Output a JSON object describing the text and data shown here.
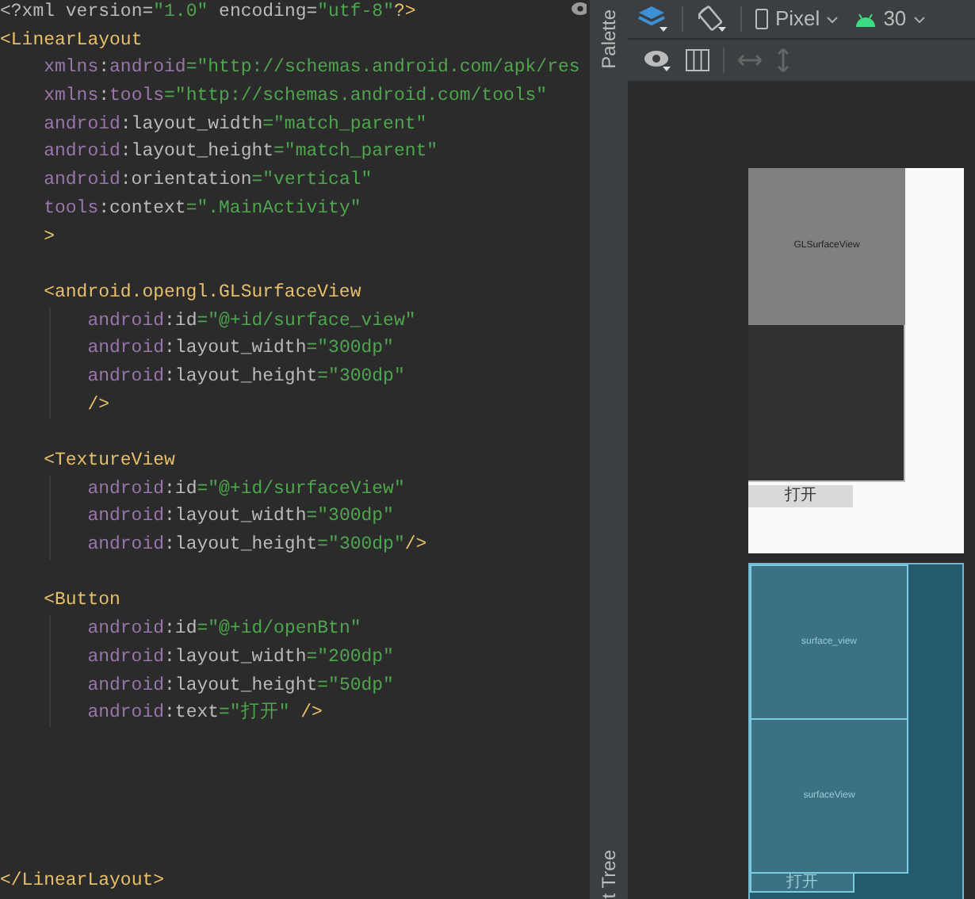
{
  "editor": {
    "prolog": [
      {
        "kind": "punct",
        "text": "<?xml version="
      },
      {
        "kind": "value",
        "text": "\"1.0\""
      },
      {
        "kind": "punct",
        "text": " encoding="
      },
      {
        "kind": "value",
        "text": "\"utf-8\""
      },
      {
        "kind": "tag",
        "text": "?>"
      }
    ],
    "root": {
      "open": [
        {
          "kind": "tag",
          "text": "<LinearLayout"
        }
      ],
      "attrs": [
        [
          {
            "kind": "ns",
            "text": "xmlns"
          },
          {
            "kind": "punct",
            "text": ":"
          },
          {
            "kind": "ns",
            "text": "android"
          },
          {
            "kind": "value",
            "text": "=\"http://schemas.android.com/apk/res"
          }
        ],
        [
          {
            "kind": "ns",
            "text": "xmlns"
          },
          {
            "kind": "punct",
            "text": ":"
          },
          {
            "kind": "ns",
            "text": "tools"
          },
          {
            "kind": "value",
            "text": "=\"http://schemas.android.com/tools\""
          }
        ],
        [
          {
            "kind": "ns",
            "text": "android"
          },
          {
            "kind": "punct",
            "text": ":layout_width"
          },
          {
            "kind": "value",
            "text": "=\"match_parent\""
          }
        ],
        [
          {
            "kind": "ns",
            "text": "android"
          },
          {
            "kind": "punct",
            "text": ":layout_height"
          },
          {
            "kind": "value",
            "text": "=\"match_parent\""
          }
        ],
        [
          {
            "kind": "ns",
            "text": "android"
          },
          {
            "kind": "punct",
            "text": ":orientation"
          },
          {
            "kind": "value",
            "text": "=\"vertical\""
          }
        ],
        [
          {
            "kind": "ns",
            "text": "tools"
          },
          {
            "kind": "punct",
            "text": ":context"
          },
          {
            "kind": "value",
            "text": "=\".MainActivity\""
          }
        ],
        [
          {
            "kind": "tag",
            "text": ">"
          }
        ]
      ],
      "children": [
        {
          "open": [
            {
              "kind": "tag",
              "text": "<android.opengl.GLSurfaceView"
            }
          ],
          "attrs": [
            [
              {
                "kind": "ns",
                "text": "android"
              },
              {
                "kind": "punct",
                "text": ":id"
              },
              {
                "kind": "value",
                "text": "=\"@+id/surface_view\""
              }
            ],
            [
              {
                "kind": "ns",
                "text": "android"
              },
              {
                "kind": "punct",
                "text": ":layout_width"
              },
              {
                "kind": "value",
                "text": "=\"300dp\""
              }
            ],
            [
              {
                "kind": "ns",
                "text": "android"
              },
              {
                "kind": "punct",
                "text": ":layout_height"
              },
              {
                "kind": "value",
                "text": "=\"300dp\""
              }
            ],
            [
              {
                "kind": "tag",
                "text": "/>"
              }
            ]
          ]
        },
        {
          "open": [
            {
              "kind": "tag",
              "text": "<TextureView"
            }
          ],
          "attrs": [
            [
              {
                "kind": "ns",
                "text": "android"
              },
              {
                "kind": "punct",
                "text": ":id"
              },
              {
                "kind": "value",
                "text": "=\"@+id/surfaceView\""
              }
            ],
            [
              {
                "kind": "ns",
                "text": "android"
              },
              {
                "kind": "punct",
                "text": ":layout_width"
              },
              {
                "kind": "value",
                "text": "=\"300dp\""
              }
            ],
            [
              {
                "kind": "ns",
                "text": "android"
              },
              {
                "kind": "punct",
                "text": ":layout_height"
              },
              {
                "kind": "value",
                "text": "=\"300dp\""
              },
              {
                "kind": "tag",
                "text": "/>"
              }
            ]
          ]
        },
        {
          "open": [
            {
              "kind": "tag",
              "text": "<Button"
            }
          ],
          "attrs": [
            [
              {
                "kind": "ns",
                "text": "android"
              },
              {
                "kind": "punct",
                "text": ":id"
              },
              {
                "kind": "value",
                "text": "=\"@+id/openBtn\""
              }
            ],
            [
              {
                "kind": "ns",
                "text": "android"
              },
              {
                "kind": "punct",
                "text": ":layout_width"
              },
              {
                "kind": "value",
                "text": "=\"200dp\""
              }
            ],
            [
              {
                "kind": "ns",
                "text": "android"
              },
              {
                "kind": "punct",
                "text": ":layout_height"
              },
              {
                "kind": "value",
                "text": "=\"50dp\""
              }
            ],
            [
              {
                "kind": "ns",
                "text": "android"
              },
              {
                "kind": "punct",
                "text": ":text"
              },
              {
                "kind": "value",
                "text": "=\"打开\""
              },
              {
                "kind": "tag",
                "text": " />"
              }
            ]
          ]
        }
      ],
      "end": [
        {
          "kind": "tag",
          "text": "</LinearLayout>"
        }
      ]
    }
  },
  "side_tabs": [
    {
      "label": "Palette"
    },
    {
      "label": "t Tree"
    }
  ],
  "toolbar": {
    "device": "Pixel",
    "api": "30"
  },
  "preview": [
    {
      "kind": "surface",
      "label": "GLSurfaceView"
    },
    {
      "kind": "texture"
    },
    {
      "kind": "button",
      "label": "打开"
    }
  ],
  "blueprint": [
    {
      "kind": "surface",
      "label": "surface_view"
    },
    {
      "kind": "texture",
      "label": "surfaceView"
    },
    {
      "kind": "button",
      "label": "打开"
    }
  ]
}
